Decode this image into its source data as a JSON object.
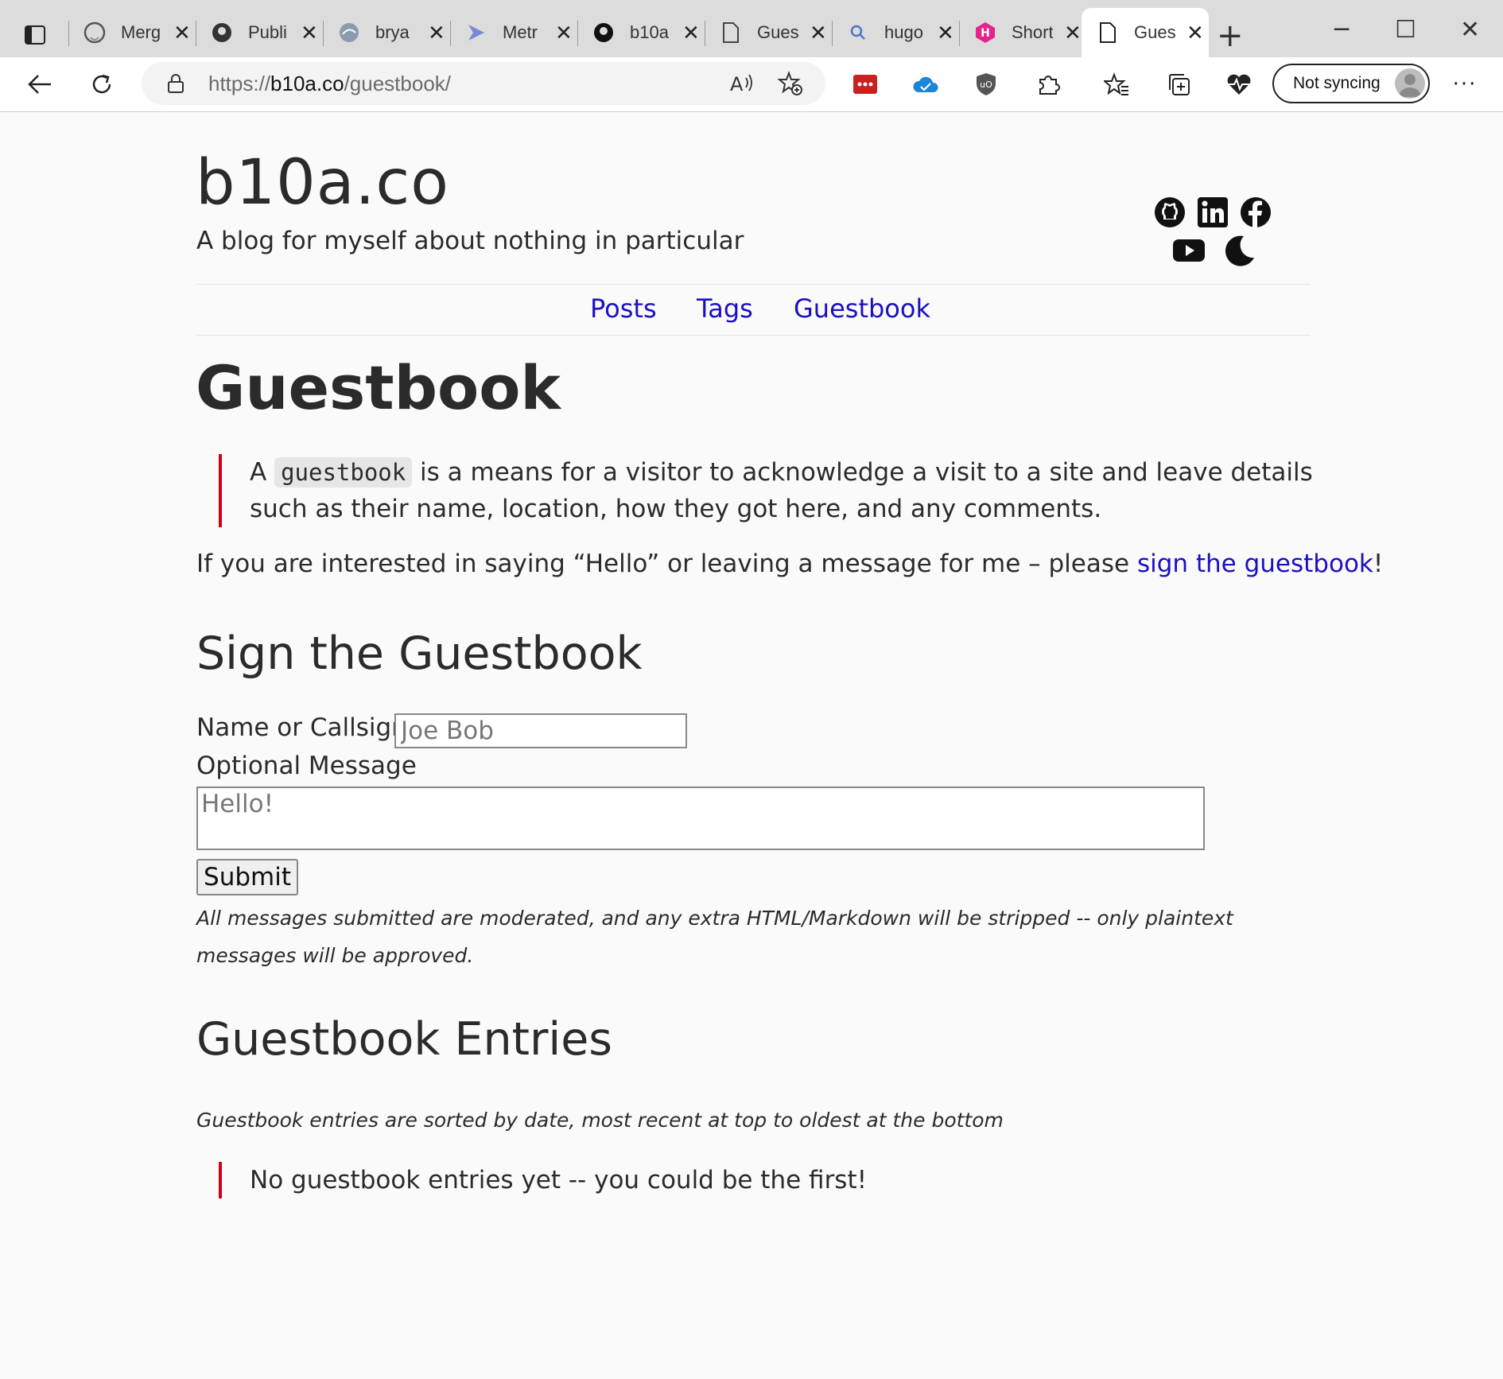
{
  "browser": {
    "tabs": [
      {
        "title": "Merg",
        "icon": "github-logo-icon"
      },
      {
        "title": "Publi",
        "icon": "github-logo-icon"
      },
      {
        "title": "brya",
        "icon": "website-icon"
      },
      {
        "title": "Metr",
        "icon": "arrow-logo-icon"
      },
      {
        "title": "b10a",
        "icon": "github-logo-icon"
      },
      {
        "title": "Gues",
        "icon": "page-icon"
      },
      {
        "title": "hugo",
        "icon": "search-icon"
      },
      {
        "title": "Short",
        "icon": "hugo-logo-icon"
      },
      {
        "title": "Gues",
        "icon": "page-icon",
        "active": true
      }
    ],
    "new_tab": "+",
    "address": {
      "prefix": "https://",
      "domain": "b10a.co",
      "path": "/guestbook/"
    },
    "sync_label": "Not syncing",
    "more_label": "···"
  },
  "site": {
    "title": "b10a.co",
    "subtitle": "A blog for myself about nothing in particular",
    "social": [
      "github-icon",
      "linkedin-icon",
      "facebook-icon",
      "youtube-icon",
      "dark-mode-moon-icon"
    ]
  },
  "nav": {
    "posts": "Posts",
    "tags": "Tags",
    "guestbook": "Guestbook"
  },
  "page": {
    "heading": "Guestbook",
    "quote_pre": "A ",
    "quote_code": "guestbook",
    "quote_line1_post": " is a means for a visitor to acknowledge a visit to a site and leave details",
    "quote_line2": "such as their name, location, how they got here, and any comments.",
    "intro_pre": "If you are interested in saying “Hello” or leaving a message for me – please ",
    "intro_link": "sign the guestbook",
    "intro_post": "!"
  },
  "form": {
    "heading": "Sign the Guestbook",
    "name_label": "Name or Callsign",
    "name_placeholder": "Joe Bob",
    "message_label": "Optional Message",
    "message_placeholder": "Hello!",
    "submit_label": "Submit",
    "note": "All messages submitted are moderated, and any extra HTML/Markdown will be stripped -- only plaintext messages will be approved."
  },
  "entries": {
    "heading": "Guestbook Entries",
    "sort_note": "Guestbook entries are sorted by date, most recent at top to oldest at the bottom",
    "empty_message": "No guestbook entries yet -- you could be the first!"
  }
}
